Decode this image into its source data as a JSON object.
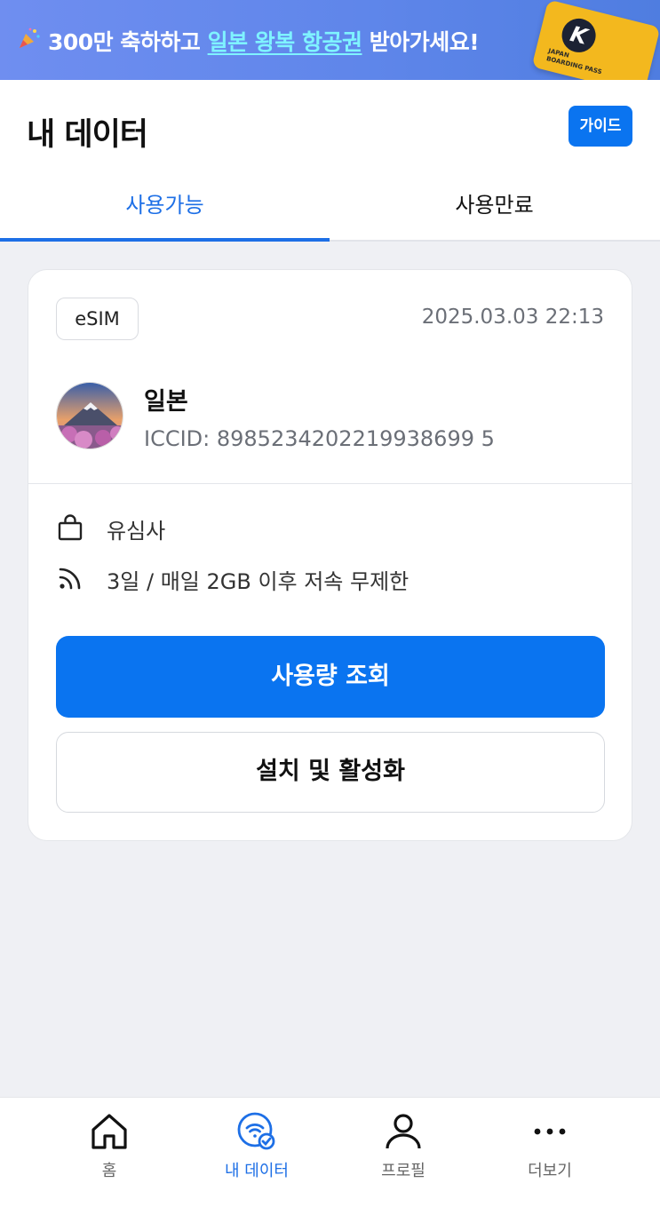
{
  "banner": {
    "text_before": "300만 축하하고 ",
    "text_highlight": "일본 왕복 항공권",
    "text_after": " 받아가세요!",
    "ticket_letter": "K",
    "ticket_caption_1": "JAPAN",
    "ticket_caption_2": "BOARDING PASS"
  },
  "header": {
    "title": "내 데이터",
    "guide_label": "가이드"
  },
  "tabs": [
    {
      "label": "사용가능",
      "active": true
    },
    {
      "label": "사용만료",
      "active": false
    }
  ],
  "card": {
    "badge": "eSIM",
    "date": "2025.03.03 22:13",
    "country": "일본",
    "iccid": "ICCID: 8985234202219938699 5",
    "vendor": "유심사",
    "plan": "3일 / 매일 2GB 이후 저속 무제한",
    "primary_button": "사용량 조회",
    "secondary_button": "설치 및 활성화"
  },
  "nav": [
    {
      "label": "홈",
      "icon": "home-icon"
    },
    {
      "label": "내 데이터",
      "icon": "wifi-check-icon",
      "active": true
    },
    {
      "label": "프로필",
      "icon": "person-icon"
    },
    {
      "label": "더보기",
      "icon": "more-dots-icon"
    }
  ],
  "colors": {
    "accent": "#0a74f0",
    "tab_active": "#1d6fe6",
    "banner_highlight": "#7ff3ff"
  }
}
